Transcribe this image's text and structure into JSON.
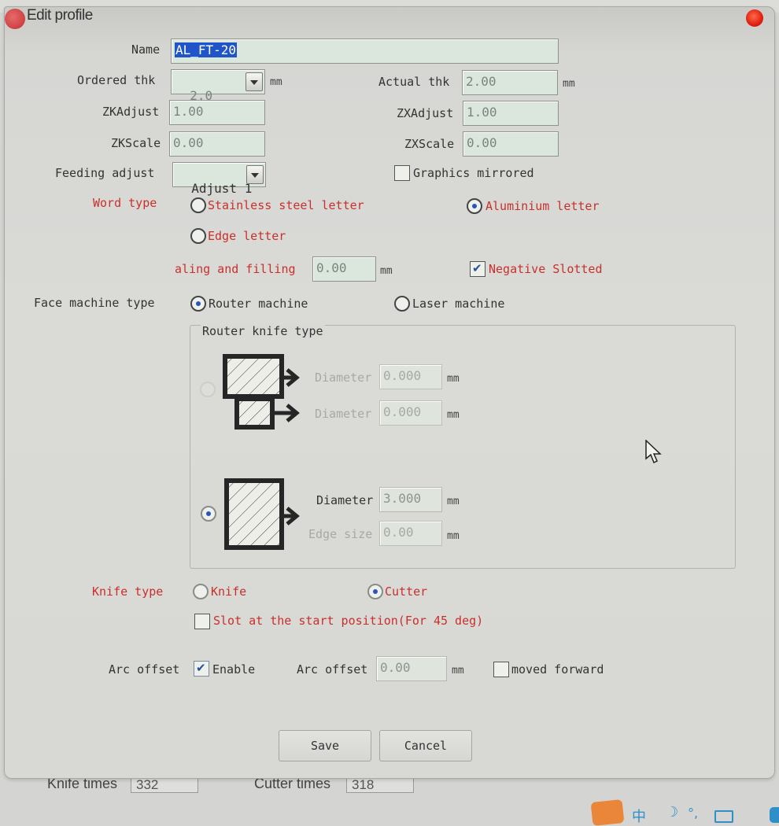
{
  "window": {
    "title": "Edit profile"
  },
  "form": {
    "name": {
      "label": "Name",
      "value": "AL_FT-20"
    },
    "ordered_thk": {
      "label": "Ordered thk",
      "value": "2.0",
      "unit": "mm"
    },
    "actual_thk": {
      "label": "Actual thk",
      "value": "2.00",
      "unit": "mm"
    },
    "zk_adjust": {
      "label": "ZKAdjust",
      "value": "1.00"
    },
    "zx_adjust": {
      "label": "ZXAdjust",
      "value": "1.00"
    },
    "zk_scale": {
      "label": "ZKScale",
      "value": "0.00"
    },
    "zx_scale": {
      "label": "ZXScale",
      "value": "0.00"
    },
    "feeding_adjust": {
      "label": "Feeding adjust",
      "value": "Adjust 1"
    },
    "graphics_mirrored": {
      "label": "Graphics mirrored",
      "checked": false
    },
    "word_type": {
      "label": "Word type",
      "options": [
        "Stainless steel letter",
        "Aluminium letter",
        "Edge letter"
      ],
      "selected": "Aluminium letter"
    },
    "sealing_filling": {
      "label": "aling and filling",
      "value": "0.00",
      "unit": "mm"
    },
    "negative_slotted": {
      "label": "Negative Slotted",
      "checked": true
    },
    "face_machine_type": {
      "label": "Face machine type",
      "options": [
        "Router machine",
        "Laser machine"
      ],
      "selected": "Router machine"
    },
    "router_knife_type": {
      "title": "Router knife type",
      "double": {
        "selected": false,
        "diameter1": {
          "label": "Diameter",
          "value": "0.000",
          "unit": "mm"
        },
        "diameter2": {
          "label": "Diameter",
          "value": "0.000",
          "unit": "mm"
        }
      },
      "single": {
        "selected": true,
        "diameter": {
          "label": "Diameter",
          "value": "3.000",
          "unit": "mm"
        },
        "edge_size": {
          "label": "Edge size",
          "value": "0.00",
          "unit": "mm"
        }
      }
    },
    "knife_type": {
      "label": "Knife type",
      "options": [
        "Knife",
        "Cutter"
      ],
      "selected": "Cutter"
    },
    "slot_at_start": {
      "label": "Slot at the start position(For 45 deg)",
      "checked": false
    },
    "arc_offset": {
      "label": "Arc offset",
      "enable_label": "Enable",
      "enabled": true,
      "value_label": "Arc offset",
      "value": "0.00",
      "unit": "mm",
      "moved_forward_label": "moved forward",
      "moved_forward": false
    }
  },
  "buttons": {
    "save": "Save",
    "cancel": "Cancel"
  },
  "background_window": {
    "knife_times_label": "Knife times",
    "knife_times_value": "332",
    "cutter_times_label": "Cutter times",
    "cutter_times_value": "318"
  },
  "taskbar": {
    "ime_label": "中"
  }
}
